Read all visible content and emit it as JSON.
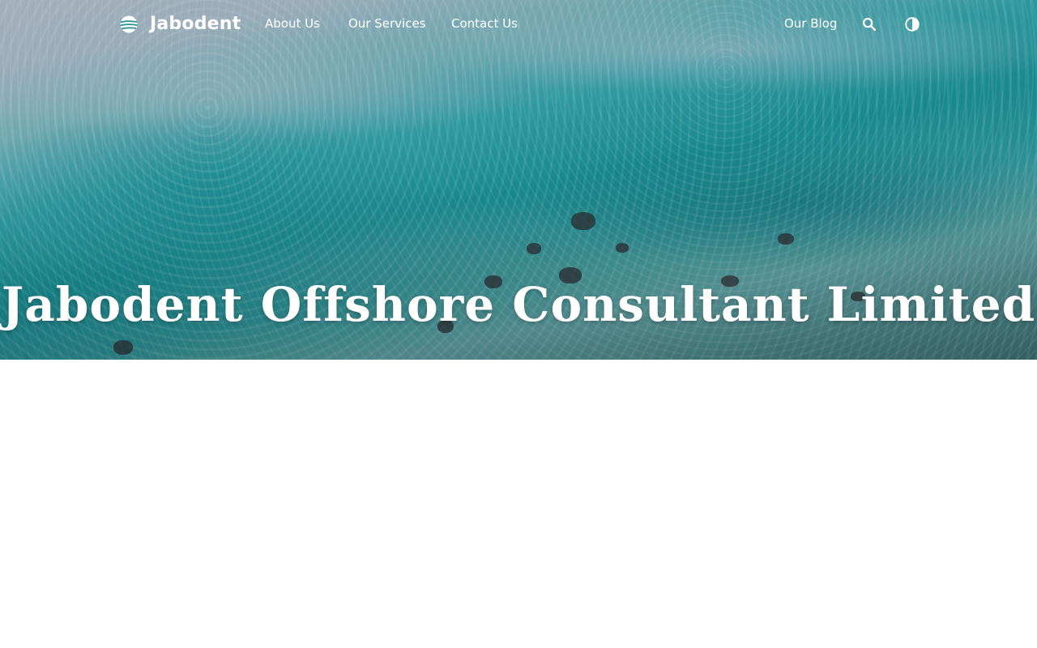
{
  "brand": {
    "name": "Jabodent",
    "logo_icon": "globe-waves-icon"
  },
  "nav": {
    "about": "About Us",
    "services": "Our Services",
    "contact": "Contact Us",
    "blog": "Our Blog",
    "search_icon": "search-icon",
    "theme_icon": "contrast-toggle-icon"
  },
  "hero": {
    "title": "Jabodent Offshore Consultant Limited",
    "background": "aerial-ocean-waves-image"
  },
  "colors": {
    "text_on_hero": "#ffffff",
    "page_background": "#ffffff",
    "sea_teal": "#188a8f"
  }
}
